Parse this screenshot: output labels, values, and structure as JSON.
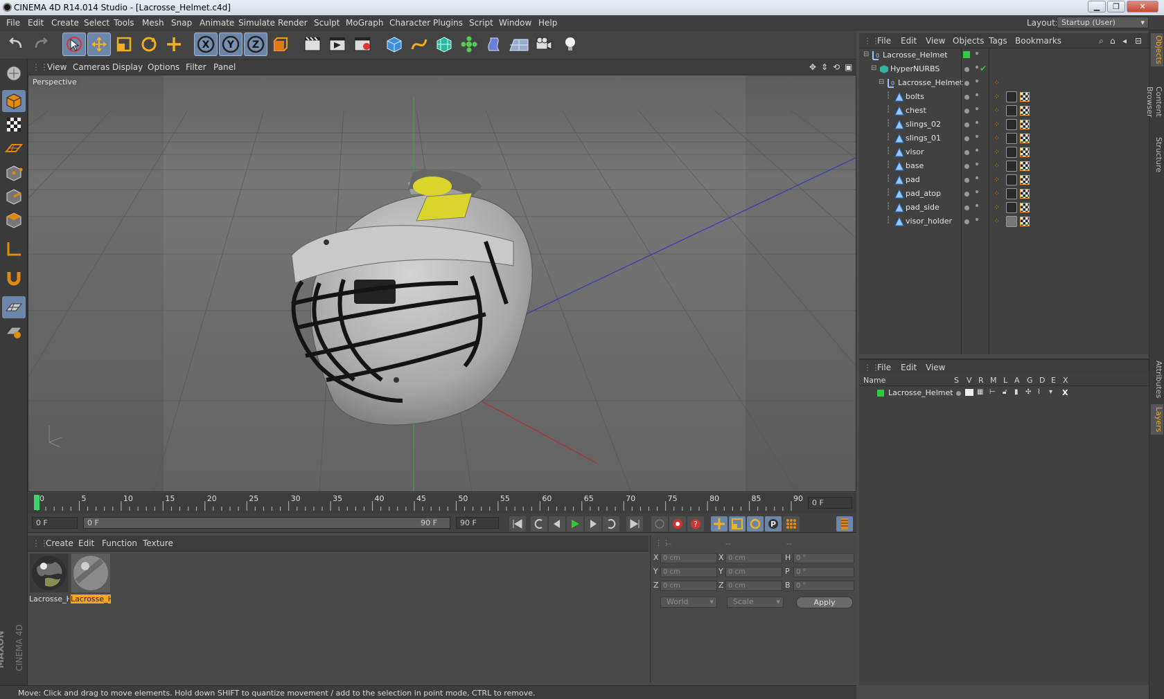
{
  "window": {
    "title": "CINEMA 4D R14.014 Studio - [Lacrosse_Helmet.c4d]"
  },
  "menubar": {
    "items": [
      "File",
      "Edit",
      "Create",
      "Select",
      "Tools",
      "Mesh",
      "Snap",
      "Animate",
      "Simulate",
      "Render",
      "Sculpt",
      "MoGraph",
      "Character",
      "Plugins",
      "Script",
      "Window",
      "Help"
    ],
    "layout_label": "Layout:",
    "layout_value": "Startup (User)"
  },
  "toolbar": {
    "icons": [
      "undo-icon",
      "redo-icon",
      "live-selection-icon",
      "move-icon",
      "scale-icon",
      "rotate-icon",
      "add-icon",
      "x-axis-icon",
      "y-axis-icon",
      "z-axis-icon",
      "coordinate-system-icon",
      "render-view-icon",
      "render-picture-viewer-icon",
      "edit-render-settings-icon",
      "cube-icon",
      "spline-pen-icon",
      "subdivision-surface-icon",
      "cloner-icon",
      "deformer-icon",
      "floor-icon",
      "camera-icon",
      "light-icon"
    ],
    "axis_labels": {
      "x": "X",
      "y": "Y",
      "z": "Z"
    }
  },
  "viewport": {
    "menu": [
      "View",
      "Cameras",
      "Display",
      "Options",
      "Filter",
      "Panel"
    ],
    "label": "Perspective"
  },
  "timeline": {
    "ticks": [
      "0",
      "5",
      "10",
      "15",
      "20",
      "25",
      "30",
      "35",
      "40",
      "45",
      "50",
      "55",
      "60",
      "65",
      "70",
      "75",
      "80",
      "85",
      "90"
    ],
    "current_frame": "0 F",
    "start_field": "0 F",
    "slider_start": "0 F",
    "slider_end": "90 F",
    "end_field": "90 F"
  },
  "material_manager": {
    "menu": [
      "Create",
      "Edit",
      "Function",
      "Texture"
    ],
    "materials": [
      {
        "name": "Lacrosse_H",
        "selected": false
      },
      {
        "name": "Lacrosse_H",
        "selected": true
      }
    ]
  },
  "coordinates": {
    "headers": [
      "--",
      "--",
      "--"
    ],
    "rows": [
      {
        "a": "X",
        "av": "0 cm",
        "b": "X",
        "bv": "0 cm",
        "c": "H",
        "cv": "0 °"
      },
      {
        "a": "Y",
        "av": "0 cm",
        "b": "Y",
        "bv": "0 cm",
        "c": "P",
        "cv": "0 °"
      },
      {
        "a": "Z",
        "av": "0 cm",
        "b": "Z",
        "bv": "0 cm",
        "c": "B",
        "cv": "0 °"
      }
    ],
    "mode": "World",
    "scale": "Scale",
    "apply": "Apply"
  },
  "status": {
    "text": "Move: Click and drag to move elements. Hold down SHIFT to quantize movement / add to the selection in point mode, CTRL to remove."
  },
  "brand": {
    "maxon": "MAXON",
    "product": "CINEMA 4D"
  },
  "object_manager": {
    "menu": [
      "File",
      "Edit",
      "View",
      "Objects",
      "Tags",
      "Bookmarks"
    ],
    "objects": [
      {
        "name": "Lacrosse_Helmet",
        "indent": 0,
        "kind": "null"
      },
      {
        "name": "HyperNURBS",
        "indent": 1,
        "kind": "hypernurbs"
      },
      {
        "name": "Lacrosse_Helmet",
        "indent": 2,
        "kind": "null"
      },
      {
        "name": "bolts",
        "indent": 3,
        "kind": "poly"
      },
      {
        "name": "chest",
        "indent": 3,
        "kind": "poly"
      },
      {
        "name": "slings_02",
        "indent": 3,
        "kind": "poly"
      },
      {
        "name": "slings_01",
        "indent": 3,
        "kind": "poly"
      },
      {
        "name": "visor",
        "indent": 3,
        "kind": "poly"
      },
      {
        "name": "base",
        "indent": 3,
        "kind": "poly"
      },
      {
        "name": "pad",
        "indent": 3,
        "kind": "poly"
      },
      {
        "name": "pad_atop",
        "indent": 3,
        "kind": "poly"
      },
      {
        "name": "pad_side",
        "indent": 3,
        "kind": "poly"
      },
      {
        "name": "visor_holder",
        "indent": 3,
        "kind": "poly"
      }
    ]
  },
  "layer_manager": {
    "menu": [
      "File",
      "Edit",
      "View"
    ],
    "columns": [
      "Name",
      "S",
      "V",
      "R",
      "M",
      "L",
      "A",
      "G",
      "D",
      "E",
      "X"
    ],
    "layers": [
      {
        "name": "Lacrosse_Helmet",
        "color": "#2ecc40"
      }
    ]
  },
  "right_tabs": [
    "Objects",
    "Content Browser",
    "Structure",
    "Attributes",
    "Layers"
  ],
  "colors": {
    "accent": "#f5a623",
    "selection": "#6b86a8",
    "layer_green": "#2ecc40"
  }
}
